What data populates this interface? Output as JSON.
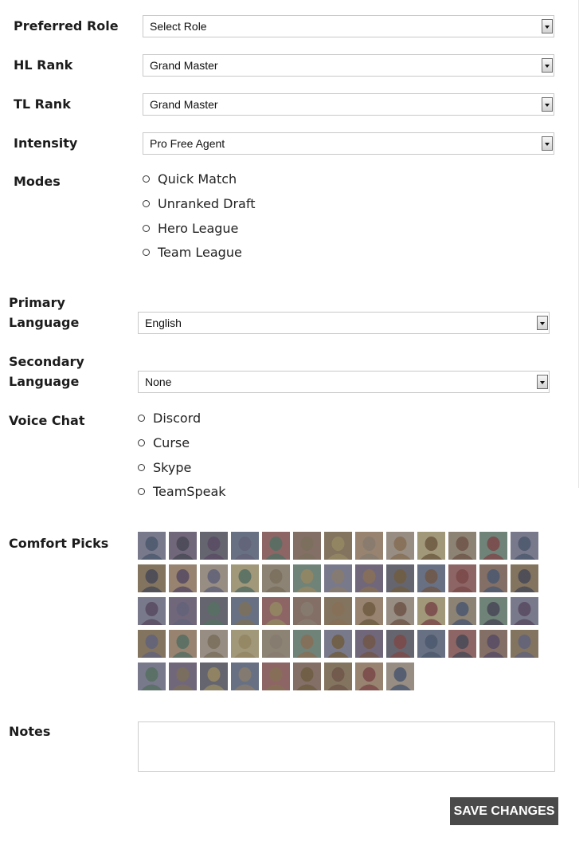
{
  "fields": {
    "preferred_role": {
      "label": "Preferred Role",
      "value": "Select Role"
    },
    "hl_rank": {
      "label": "HL Rank",
      "value": "Grand Master"
    },
    "tl_rank": {
      "label": "TL Rank",
      "value": "Grand Master"
    },
    "intensity": {
      "label": "Intensity",
      "value": "Pro Free Agent"
    }
  },
  "modes": {
    "label": "Modes",
    "options": [
      "Quick Match",
      "Unranked Draft",
      "Hero League",
      "Team League"
    ]
  },
  "primary_language": {
    "label_line1": "Primary",
    "label_line2": "Language",
    "value": "English"
  },
  "secondary_language": {
    "label_line1": "Secondary",
    "label_line2": "Language",
    "value": "None"
  },
  "voice_chat": {
    "label": "Voice Chat",
    "options": [
      "Discord",
      "Curse",
      "Skype",
      "TeamSpeak"
    ]
  },
  "comfort_picks": {
    "label": "Comfort Picks",
    "count": 61,
    "columns": 13
  },
  "notes": {
    "label": "Notes",
    "value": ""
  },
  "save_button": {
    "label": "SAVE CHANGES"
  },
  "colors": {
    "button_bg": "#4a4a4a",
    "portrait_palette": [
      "#5a5a78",
      "#6b4a3a",
      "#7a6a52",
      "#3e4e6a",
      "#8a7a6a",
      "#4e3c5c",
      "#6a5230",
      "#4a6a5a",
      "#7a3a3a",
      "#9a8a5a",
      "#3a3a4a",
      "#8a6a4a"
    ]
  }
}
